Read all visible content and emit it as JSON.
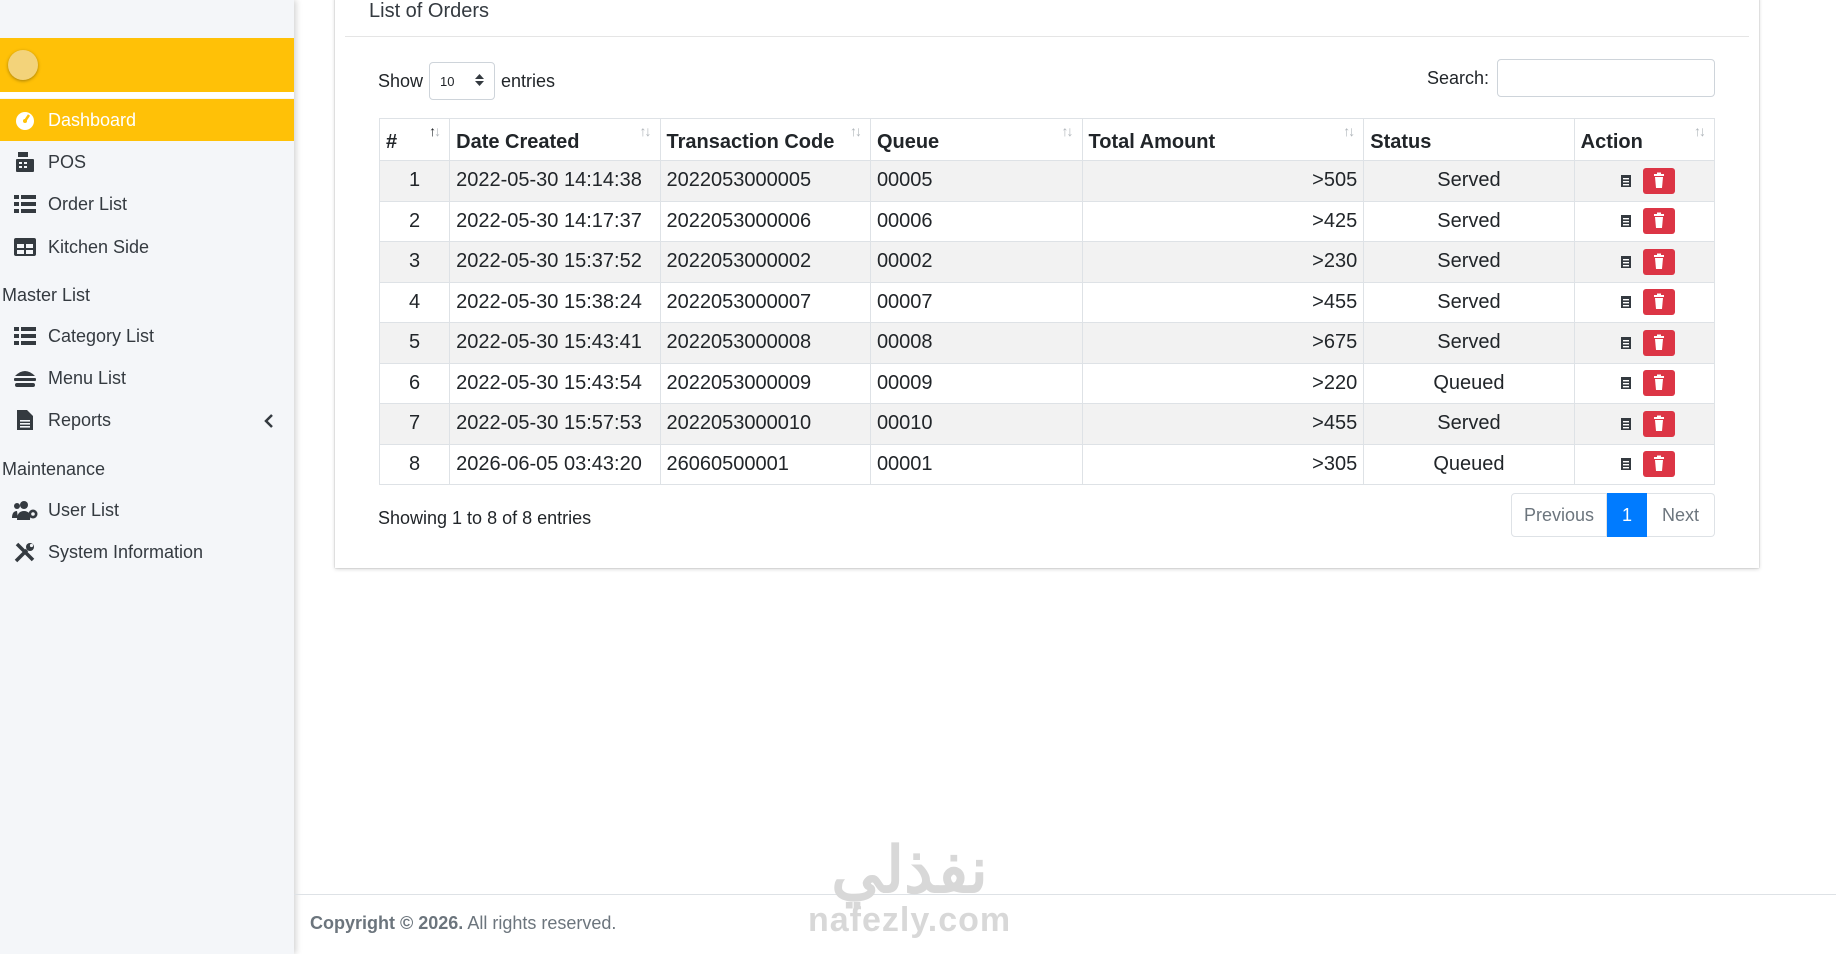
{
  "sidebar": {
    "nav": [
      {
        "label": "Dashboard",
        "icon": "gauge-icon",
        "active": true
      },
      {
        "label": "POS",
        "icon": "cash-register-icon"
      },
      {
        "label": "Order List",
        "icon": "list-icon"
      },
      {
        "label": "Kitchen Side",
        "icon": "table-icon"
      }
    ],
    "sections": [
      {
        "header": "Master List",
        "items": [
          {
            "label": "Category List",
            "icon": "list-icon"
          },
          {
            "label": "Menu List",
            "icon": "hamburger-icon"
          },
          {
            "label": "Reports",
            "icon": "file-icon",
            "has_submenu": true
          }
        ]
      },
      {
        "header": "Maintenance",
        "items": [
          {
            "label": "User List",
            "icon": "users-cog-icon"
          },
          {
            "label": "System Information",
            "icon": "tools-icon"
          }
        ]
      }
    ]
  },
  "main": {
    "title": "List of Orders",
    "length": {
      "show_label": "Show",
      "value": "10",
      "entries_label": "entries"
    },
    "search": {
      "label": "Search:",
      "value": ""
    },
    "table": {
      "columns": [
        "#",
        "Date Created",
        "Transaction Code",
        "Queue",
        "Total Amount",
        "Status",
        "Action"
      ],
      "rows": [
        {
          "num": "1",
          "date": "2022-05-30 14:14:38",
          "code": "2022053000005",
          "queue": "00005",
          "amount": ">505",
          "status": "Served"
        },
        {
          "num": "2",
          "date": "2022-05-30 14:17:37",
          "code": "2022053000006",
          "queue": "00006",
          "amount": ">425",
          "status": "Served"
        },
        {
          "num": "3",
          "date": "2022-05-30 15:37:52",
          "code": "2022053000002",
          "queue": "00002",
          "amount": ">230",
          "status": "Served"
        },
        {
          "num": "4",
          "date": "2022-05-30 15:38:24",
          "code": "2022053000007",
          "queue": "00007",
          "amount": ">455",
          "status": "Served"
        },
        {
          "num": "5",
          "date": "2022-05-30 15:43:41",
          "code": "2022053000008",
          "queue": "00008",
          "amount": ">675",
          "status": "Served"
        },
        {
          "num": "6",
          "date": "2022-05-30 15:43:54",
          "code": "2022053000009",
          "queue": "00009",
          "amount": ">220",
          "status": "Queued"
        },
        {
          "num": "7",
          "date": "2022-05-30 15:57:53",
          "code": "2022053000010",
          "queue": "00010",
          "amount": ">455",
          "status": "Served"
        },
        {
          "num": "8",
          "date": "2026-06-05 03:43:20",
          "code": "26060500001",
          "queue": "00001",
          "amount": ">305",
          "status": "Queued"
        }
      ]
    },
    "info": "Showing 1 to 8 of 8 entries",
    "pagination": {
      "previous": "Previous",
      "current": "1",
      "next": "Next"
    }
  },
  "footer": {
    "copyright": "Copyright © 2026.",
    "rights": "All rights reserved."
  },
  "watermark": {
    "arabic": "نفذلي",
    "latin": "nafezly.com"
  },
  "colors": {
    "brand": "#ffc107",
    "primary": "#007bff",
    "danger": "#dc3545"
  }
}
